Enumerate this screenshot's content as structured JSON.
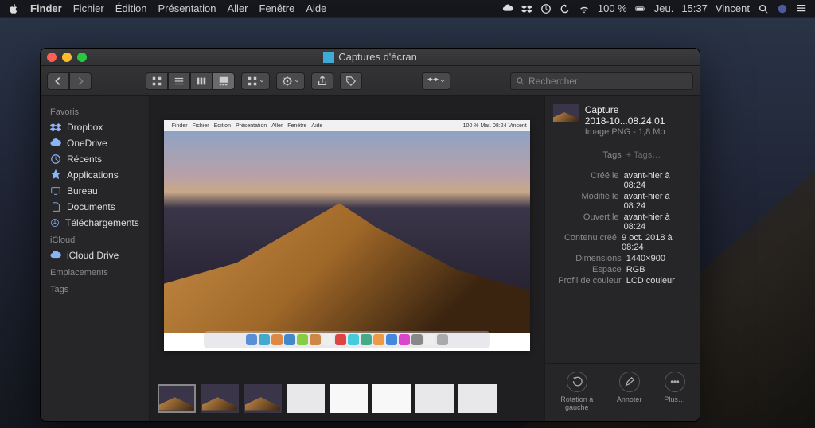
{
  "menubar": {
    "app": "Finder",
    "items": [
      "Fichier",
      "Édition",
      "Présentation",
      "Aller",
      "Fenêtre",
      "Aide"
    ],
    "battery": "100 %",
    "day": "Jeu.",
    "time": "15:37",
    "user": "Vincent"
  },
  "window": {
    "title": "Captures d'écran",
    "search_placeholder": "Rechercher"
  },
  "sidebar": {
    "sections": [
      {
        "head": "Favoris",
        "items": [
          "Dropbox",
          "OneDrive",
          "Récents",
          "Applications",
          "Bureau",
          "Documents",
          "Téléchargements"
        ]
      },
      {
        "head": "iCloud",
        "items": [
          "iCloud Drive"
        ]
      },
      {
        "head": "Emplacements",
        "items": []
      },
      {
        "head": "Tags",
        "items": []
      }
    ]
  },
  "file": {
    "name_line1": "Capture",
    "name_line2": "2018-10...08.24.01",
    "kind": "Image PNG - 1,8 Mo",
    "tags_label": "Tags",
    "tags_value": "+ Tags…",
    "meta": [
      {
        "k": "Créé le",
        "v": "avant-hier à 08:24"
      },
      {
        "k": "Modifié le",
        "v": "avant-hier à 08:24"
      },
      {
        "k": "Ouvert le",
        "v": "avant-hier à 08:24"
      },
      {
        "k": "Contenu créé",
        "v": "9 oct. 2018 à 08:24"
      },
      {
        "k": "Dimensions",
        "v": "1440×900"
      },
      {
        "k": "Espace",
        "v": "RGB"
      },
      {
        "k": "Profil de couleur",
        "v": "LCD couleur"
      }
    ]
  },
  "actions": {
    "rotate": "Rotation à gauche",
    "annotate": "Annoter",
    "more": "Plus…"
  },
  "mini_menubar": [
    "Finder",
    "Fichier",
    "Édition",
    "Présentation",
    "Aller",
    "Fenêtre",
    "Aide"
  ],
  "mini_right": "100 %   Mar. 08:24   Vincent"
}
